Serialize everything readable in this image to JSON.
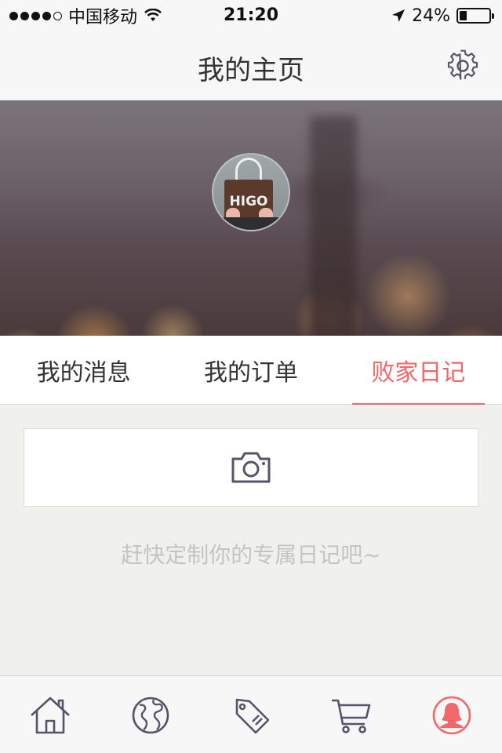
{
  "status_bar": {
    "carrier": "中国移动",
    "time": "21:20",
    "battery_text": "24%",
    "battery_level": 0.24,
    "signal_bars": 4
  },
  "nav": {
    "title": "我的主页",
    "settings_icon": "gear-icon"
  },
  "profile": {
    "avatar_brand_text": "HIGO"
  },
  "tabs": [
    {
      "label": "我的消息",
      "active": false
    },
    {
      "label": "我的订单",
      "active": false
    },
    {
      "label": "败家日记",
      "active": true
    }
  ],
  "diary": {
    "add_icon": "camera-icon",
    "hint": "赶快定制你的专属日记吧~"
  },
  "tab_bar": {
    "items": [
      {
        "icon": "home-icon",
        "active": false
      },
      {
        "icon": "globe-icon",
        "active": false
      },
      {
        "icon": "tag-icon",
        "active": false
      },
      {
        "icon": "cart-icon",
        "active": false
      },
      {
        "icon": "user-icon",
        "active": true
      }
    ]
  },
  "colors": {
    "accent": "#f0686a",
    "icon_gray": "#55556a",
    "hint_gray": "#c4c4c0"
  }
}
